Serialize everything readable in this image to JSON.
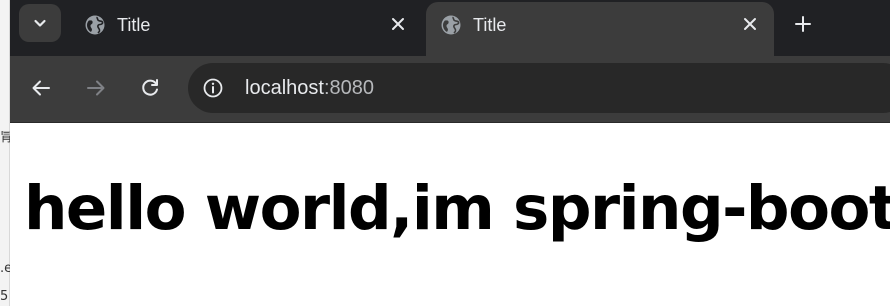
{
  "tabs": [
    {
      "title": "Title",
      "favicon": "globe-icon",
      "close_glyph": "✕",
      "active": false
    },
    {
      "title": "Title",
      "favicon": "globe-icon",
      "close_glyph": "✕",
      "active": true
    }
  ],
  "tab_strip": {
    "search_tabs_icon": "chevron-down-icon",
    "new_tab_glyph": "+"
  },
  "toolbar": {
    "back_icon": "arrow-left-icon",
    "forward_icon": "arrow-right-icon",
    "reload_icon": "reload-icon",
    "site_info_icon": "info-icon",
    "url": {
      "host": "localhost",
      "port": ":8080"
    }
  },
  "page": {
    "heading": "hello world,im spring-boot"
  },
  "colors": {
    "tab_strip_bg": "#202124",
    "active_tab_bg": "#3c3c3c",
    "toolbar_bg": "#3c3c3c",
    "omnibox_bg": "#282828",
    "chrome_text": "#e8eaed",
    "page_bg": "#ffffff",
    "heading_text": "#000000"
  }
}
